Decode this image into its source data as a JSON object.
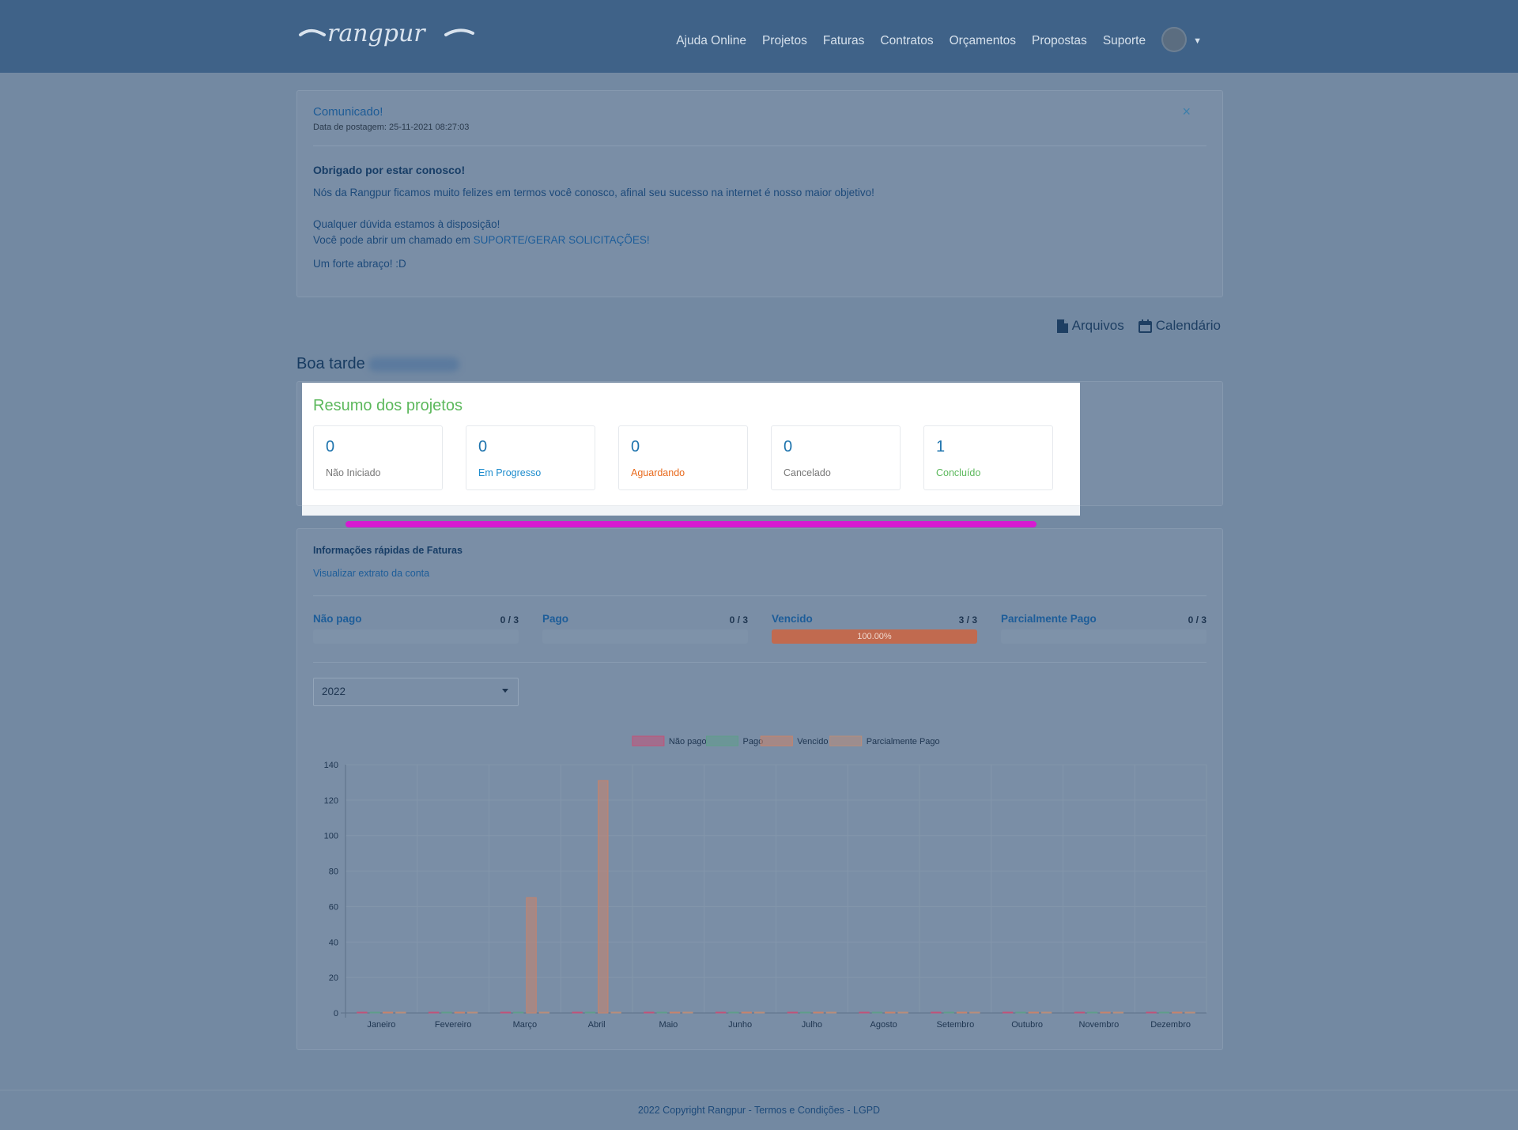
{
  "brand": {
    "logo_text": "rangpur"
  },
  "nav": {
    "items": [
      "Ajuda Online",
      "Projetos",
      "Faturas",
      "Contratos",
      "Orçamentos",
      "Propostas",
      "Suporte"
    ]
  },
  "announcement": {
    "title": "Comunicado!",
    "date": "Data de postagem: 25-11-2021 08:27:03",
    "close": "×",
    "heading": "Obrigado por estar conosco!",
    "line1": "Nós da Rangpur ficamos muito felizes em termos você conosco, afinal seu sucesso na internet é nosso maior objetivo!",
    "line2": "Qualquer dúvida estamos à disposição!",
    "line3_prefix": "Você pode abrir um chamado em ",
    "line3_link": "SUPORTE/GERAR SOLICITAÇÕES!",
    "line4": "Um forte abraço! :D"
  },
  "quick_links": {
    "files": "Arquivos",
    "calendar": "Calendário"
  },
  "greeting": "Boa tarde",
  "projects": {
    "title": "Resumo dos projetos",
    "stats": [
      {
        "value": "0",
        "label": "Não Iniciado",
        "color": "#777777"
      },
      {
        "value": "0",
        "label": "Em Progresso",
        "color": "#1d8ccd"
      },
      {
        "value": "0",
        "label": "Aguardando",
        "color": "#e86a1d"
      },
      {
        "value": "0",
        "label": "Cancelado",
        "color": "#777777"
      },
      {
        "value": "1",
        "label": "Concluído",
        "color": "#5cb85c"
      }
    ]
  },
  "invoices": {
    "title": "Informações rápidas de Faturas",
    "statement_link": "Visualizar extrato da conta",
    "stats": [
      {
        "label": "Não pago",
        "count": "0 / 3",
        "fraction": 0
      },
      {
        "label": "Pago",
        "count": "0 / 3",
        "fraction": 0
      },
      {
        "label": "Vencido",
        "count": "3 / 3",
        "fraction": 1,
        "bar_text": "100.00%"
      },
      {
        "label": "Parcialmente Pago",
        "count": "0 / 3",
        "fraction": 0
      }
    ],
    "year": "2022"
  },
  "chart_data": {
    "type": "bar",
    "categories": [
      "Janeiro",
      "Fevereiro",
      "Março",
      "Abril",
      "Maio",
      "Junho",
      "Julho",
      "Agosto",
      "Setembro",
      "Outubro",
      "Novembro",
      "Dezembro"
    ],
    "series": [
      {
        "name": "Não pago",
        "color": "#c25278",
        "values": [
          0,
          0,
          0,
          0,
          0,
          0,
          0,
          0,
          0,
          0,
          0,
          0
        ]
      },
      {
        "name": "Pago",
        "color": "#5f9d8a",
        "values": [
          0,
          0,
          0,
          0,
          0,
          0,
          0,
          0,
          0,
          0,
          0,
          0
        ]
      },
      {
        "name": "Vencido",
        "color": "#c8836b",
        "values": [
          0,
          0,
          65,
          131,
          0,
          0,
          0,
          0,
          0,
          0,
          0,
          0
        ]
      },
      {
        "name": "Parcialmente Pago",
        "color": "#b98d7a",
        "values": [
          0,
          0,
          0,
          0,
          0,
          0,
          0,
          0,
          0,
          0,
          0,
          0
        ]
      }
    ],
    "ylim": [
      0,
      140
    ],
    "yticks": [
      0,
      20,
      40,
      60,
      80,
      100,
      120,
      140
    ],
    "grid": true,
    "legend": "top-center"
  },
  "footer": {
    "text": "2022 Copyright Rangpur - ",
    "terms": "Termos e Condições",
    "sep": " - ",
    "lgpd": "LGPD"
  }
}
